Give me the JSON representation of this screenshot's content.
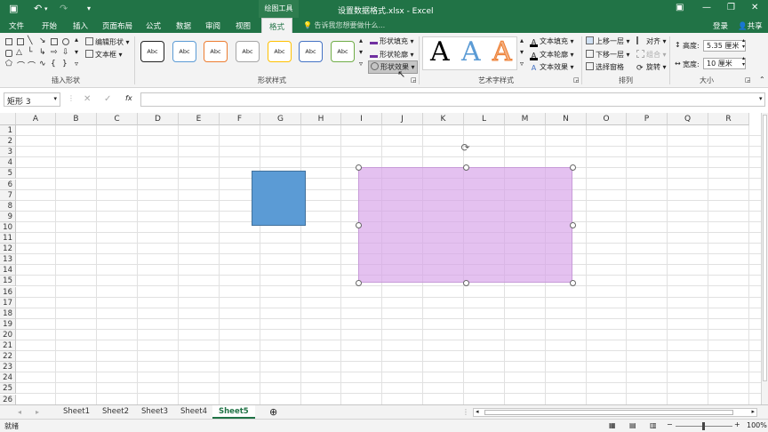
{
  "titlebar": {
    "context_tool": "绘图工具",
    "document_title": "设置数据格式.xlsx - Excel"
  },
  "tabs": [
    "文件",
    "开始",
    "插入",
    "页面布局",
    "公式",
    "数据",
    "审阅",
    "视图",
    "格式"
  ],
  "tell_me": "告诉我您想要做什么...",
  "login": "登录",
  "share": "共享",
  "ribbon": {
    "insert_shapes": {
      "edit_shape": "编辑形状",
      "text_box": "文本框",
      "label": "插入形状"
    },
    "shape_styles": {
      "swatch_text": "Abc",
      "label": "形状样式",
      "fill": "形状填充",
      "outline": "形状轮廓",
      "effects": "形状效果"
    },
    "wordart": {
      "letter": "A",
      "text_fill": "文本填充",
      "text_outline": "文本轮廓",
      "text_effects": "文本效果",
      "label": "艺术字样式"
    },
    "arrange": {
      "bring_forward": "上移一层",
      "send_backward": "下移一层",
      "selection_pane": "选择窗格",
      "align": "对齐",
      "group": "组合",
      "rotate": "旋转",
      "label": "排列"
    },
    "size": {
      "height_label": "高度:",
      "height_value": "5.35 厘米",
      "width_label": "宽度:",
      "width_value": "10 厘米",
      "label": "大小"
    }
  },
  "namebox": "矩形 3",
  "fx": "fx",
  "columns": [
    "A",
    "B",
    "C",
    "D",
    "E",
    "F",
    "G",
    "H",
    "I",
    "J",
    "K",
    "L",
    "M",
    "N",
    "O",
    "P",
    "Q",
    "R"
  ],
  "rows": [
    "1",
    "2",
    "3",
    "4",
    "5",
    "6",
    "7",
    "8",
    "9",
    "10",
    "11",
    "12",
    "13",
    "14",
    "15",
    "16",
    "17",
    "18",
    "19",
    "20",
    "21",
    "22",
    "23",
    "24",
    "25",
    "26"
  ],
  "sheets": [
    "Sheet1",
    "Sheet2",
    "Sheet3",
    "Sheet4",
    "Sheet5"
  ],
  "active_sheet": "Sheet5",
  "status": {
    "ready": "就绪",
    "zoom": "100%"
  },
  "colors": {
    "brand": "#217346",
    "blue_shape": "#5b9bd5",
    "pink_shape": "#e3b5ee"
  }
}
